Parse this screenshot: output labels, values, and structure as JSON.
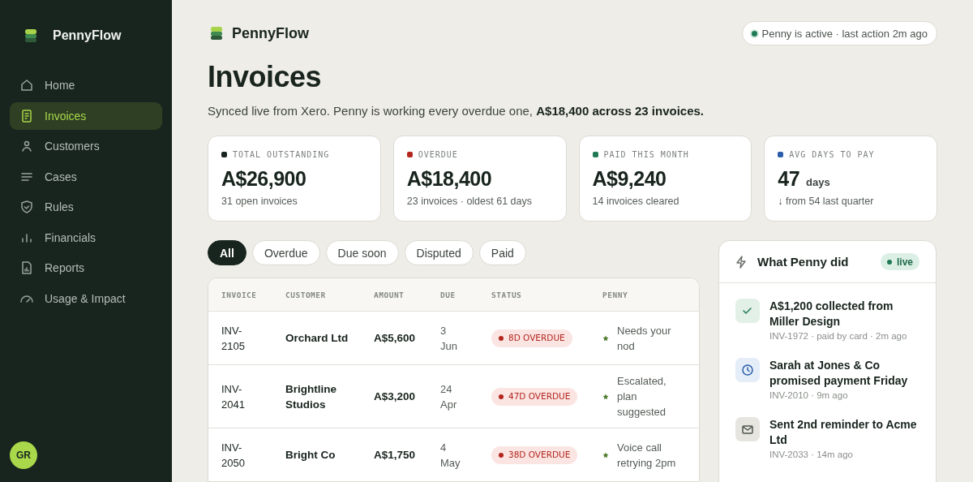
{
  "sidebar": {
    "brand": "PennyFlow",
    "items": [
      {
        "label": "Home",
        "selected": false
      },
      {
        "label": "Invoices",
        "selected": true
      },
      {
        "label": "Customers",
        "selected": false
      },
      {
        "label": "Cases",
        "selected": false
      },
      {
        "label": "Rules",
        "selected": false
      },
      {
        "label": "Financials",
        "selected": false
      },
      {
        "label": "Reports",
        "selected": false
      },
      {
        "label": "Usage & Impact",
        "selected": false
      }
    ],
    "avatar": "GR"
  },
  "header": {
    "brand": "PennyFlow",
    "status": "Penny is active · last action 2m ago"
  },
  "page": {
    "title": "Invoices",
    "subtitle": "Synced live from Xero. Penny is working every overdue one, **A$18,400 across 23 invoices.**"
  },
  "stats": [
    {
      "label": "TOTAL OUTSTANDING",
      "color": "#18241d",
      "value": "A$26,900",
      "note": "31 open invoices"
    },
    {
      "label": "OVERDUE",
      "color": "#b3261e",
      "value": "A$18,400",
      "note": "23 invoices · oldest 61 days"
    },
    {
      "label": "PAID THIS MONTH",
      "color": "#1f7a55",
      "value": "A$9,240",
      "note": "14 invoices cleared"
    },
    {
      "label": "AVG DAYS TO PAY",
      "color": "#2a5ea8",
      "value": "47",
      "unit": "days",
      "note": "↓ from 54 last quarter"
    }
  ],
  "filters": [
    {
      "label": "All",
      "selected": true
    },
    {
      "label": "Overdue",
      "selected": false
    },
    {
      "label": "Due soon",
      "selected": false
    },
    {
      "label": "Disputed",
      "selected": false
    },
    {
      "label": "Paid",
      "selected": false
    }
  ],
  "table": {
    "columns": [
      "INVOICE",
      "CUSTOMER",
      "AMOUNT",
      "DUE",
      "STATUS",
      "PENNY"
    ],
    "rows": [
      {
        "invoice": "INV-2105",
        "customer": "Orchard Ltd",
        "amount": "A$5,600",
        "due": "3 Jun",
        "status": {
          "kind": "overdue",
          "label": "8D OVERDUE"
        },
        "penny": "Needs your nod"
      },
      {
        "invoice": "INV-2041",
        "customer": "Brightline Studios",
        "amount": "A$3,200",
        "due": "24 Apr",
        "status": {
          "kind": "overdue",
          "label": "47D OVERDUE"
        },
        "penny": "Escalated, plan suggested"
      },
      {
        "invoice": "INV-2050",
        "customer": "Bright Co",
        "amount": "A$1,750",
        "due": "4 May",
        "status": {
          "kind": "overdue",
          "label": "38D OVERDUE"
        },
        "penny": "Voice call retrying 2pm"
      }
    ]
  },
  "activity": {
    "title": "What Penny did",
    "badge": "live",
    "items": [
      {
        "kind": "collected",
        "text": "A$1,200 collected from Miller Design",
        "meta": "INV-1972 · paid by card · 2m ago"
      },
      {
        "kind": "promise",
        "text": "Sarah at Jones & Co promised payment Friday",
        "meta": "INV-2010 · 9m ago"
      },
      {
        "kind": "reminder",
        "text": "Sent 2nd reminder to Acme Ltd",
        "meta": "INV-2033 · 14m ago"
      }
    ]
  }
}
